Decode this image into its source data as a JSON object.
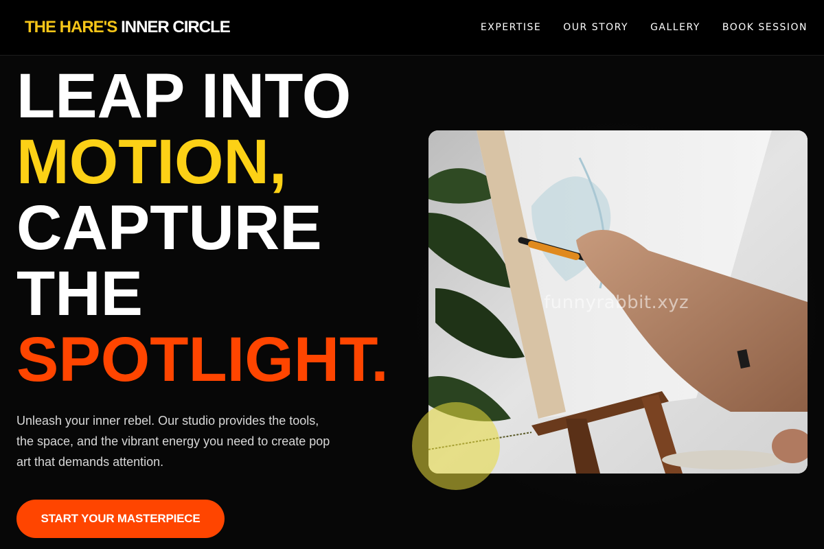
{
  "header": {
    "logo_part1": "THE HARE'S",
    "logo_part2": "INNER CIRCLE",
    "nav": [
      "EXPERTISE",
      "OUR STORY",
      "GALLERY",
      "BOOK SESSION"
    ]
  },
  "hero": {
    "headline": [
      "LEAP INTO",
      "MOTION,",
      "CAPTURE",
      "THE",
      "SPOTLIGHT."
    ],
    "subtext": "Unleash your inner rebel. Our studio provides the tools, the space, and the vibrant energy you need to create pop art that demands attention.",
    "cta_label": "START YOUR MASTERPIECE",
    "image_watermark": "funnyrabbit.xyz"
  },
  "colors": {
    "background": "#070707",
    "accent_yellow": "#fcd116",
    "accent_orange": "#ff4500",
    "text_white": "#ffffff"
  }
}
